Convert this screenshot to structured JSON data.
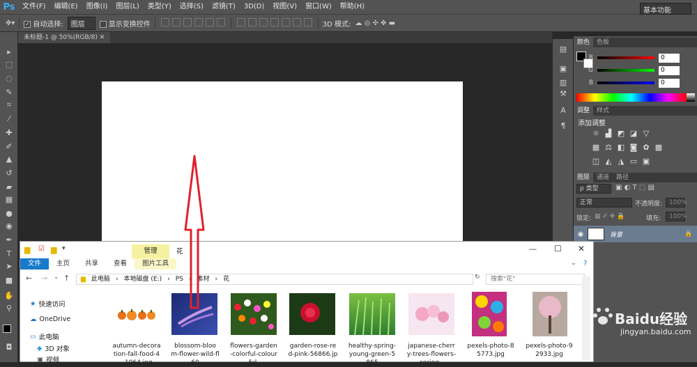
{
  "app": {
    "logo": "Ps",
    "menu": [
      "文件(F)",
      "编辑(E)",
      "图像(I)",
      "图层(L)",
      "类型(Y)",
      "选择(S)",
      "滤镜(T)",
      "3D(D)",
      "视图(V)",
      "窗口(W)",
      "帮助(H)"
    ]
  },
  "options": {
    "auto_select_label": "自动选择:",
    "auto_select_value": "图层",
    "show_transform_label": "显示变换控件",
    "mode_label": "3D 模式:",
    "workspace": "基本功能"
  },
  "document": {
    "tab_title": "未标题-1 @ 50%(RGB/8)"
  },
  "color_panel": {
    "tabs": [
      "颜色",
      "色板"
    ],
    "r_label": "R",
    "g_label": "G",
    "b_label": "B",
    "r": "0",
    "g": "0",
    "b": "0"
  },
  "adjust_panel": {
    "tabs": [
      "调整",
      "样式"
    ],
    "title": "添加调整"
  },
  "layers_panel": {
    "tabs": [
      "图层",
      "通道",
      "路径"
    ],
    "kind": "ρ 类型",
    "blend": "正常",
    "opacity_label": "不透明度:",
    "opacity": "100%",
    "lock_label": "锁定:",
    "fill_label": "填充:",
    "fill": "100%",
    "layer_name": "背景"
  },
  "explorer": {
    "ribbon_context": "管理",
    "folder_title": "花",
    "tabs": [
      "文件",
      "主页",
      "共享",
      "查看",
      "图片工具"
    ],
    "path": [
      "此电脑",
      "本地磁盘 (E:)",
      "PS",
      "素材",
      "花"
    ],
    "search_placeholder": "搜索\"花\"",
    "nav": [
      "快速访问",
      "OneDrive",
      "此电脑",
      "3D 对象",
      "视频"
    ],
    "files": [
      "autumn-decora\ntion-fall-food-4\n..1064.jpg",
      "blossom-bloo\nm-flower-wild-fl\n..60..",
      "flowers-garden\n-colorful-colour\nful.",
      "garden-rose-re\nd-pink-56866.jp",
      "healthy-spring-\nyoung-green-5\n..865..",
      "japanese-cherr\ny-trees-flowers-\nspring..",
      "pexels-photo-8\n5773.jpg",
      "pexels-photo-9\n2933.jpg"
    ]
  },
  "watermark": {
    "brand": "Baidu经验",
    "url": "jingyan.baidu.com"
  }
}
